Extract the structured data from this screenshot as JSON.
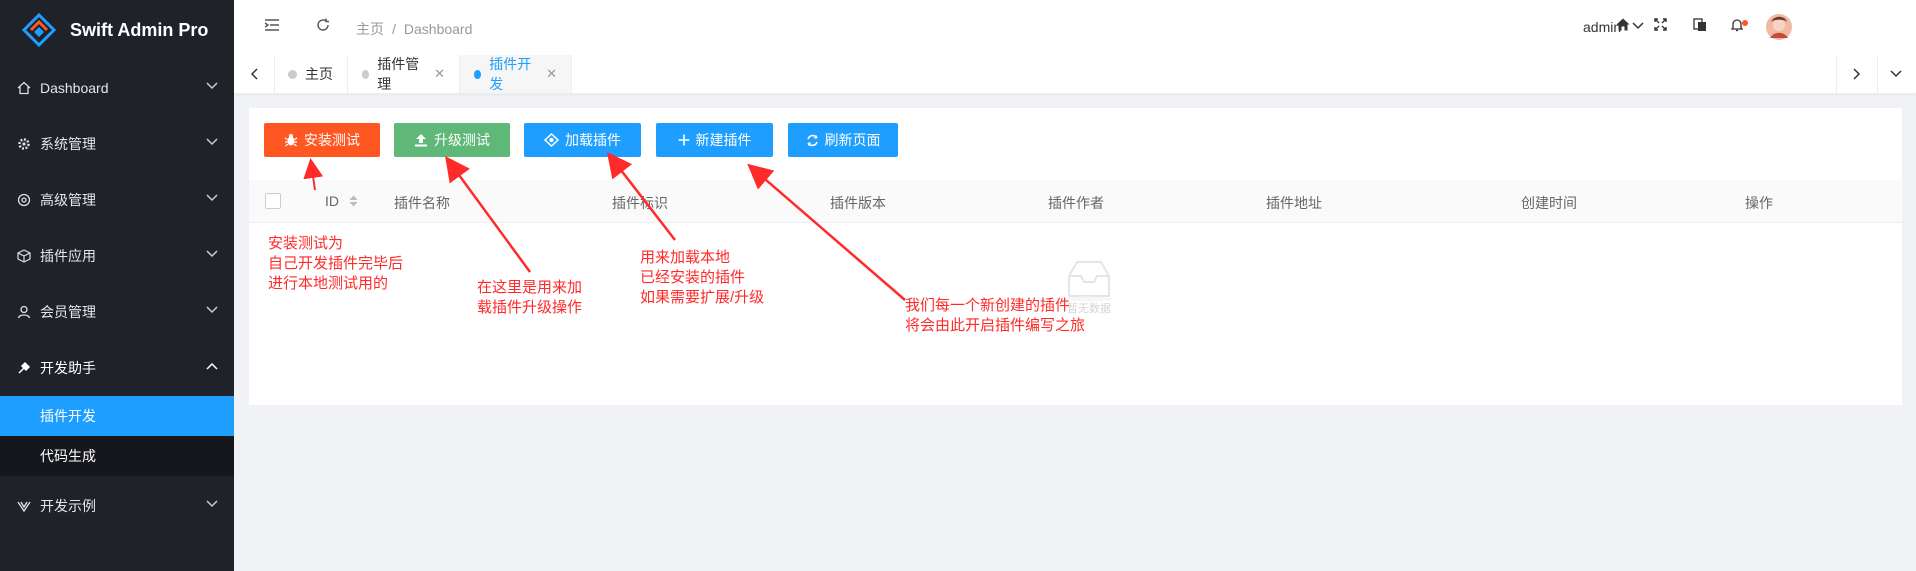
{
  "app": {
    "title": "Swift Admin Pro",
    "accent": "#1e9fff"
  },
  "sidebar": {
    "items": [
      {
        "label": "Dashboard",
        "icon": "home-icon"
      },
      {
        "label": "系统管理",
        "icon": "gear-icon"
      },
      {
        "label": "高级管理",
        "icon": "settings-icon"
      },
      {
        "label": "插件应用",
        "icon": "box-icon"
      },
      {
        "label": "会员管理",
        "icon": "user-icon"
      },
      {
        "label": "开发助手",
        "icon": "tool-icon",
        "expanded": true,
        "children": [
          {
            "label": "插件开发",
            "active": true
          },
          {
            "label": "代码生成"
          }
        ]
      },
      {
        "label": "开发示例",
        "icon": "lab-icon"
      }
    ]
  },
  "header": {
    "breadcrumb": [
      "主页",
      "Dashboard"
    ],
    "user": "admin"
  },
  "tabs": [
    {
      "label": "主页"
    },
    {
      "label": "插件管理"
    },
    {
      "label": "插件开发",
      "active": true
    }
  ],
  "toolbar": {
    "buttons": [
      {
        "label": "安装测试",
        "color": "#ff5722",
        "icon": "bug-icon"
      },
      {
        "label": "升级测试",
        "color": "#5fb878",
        "icon": "upload-icon"
      },
      {
        "label": "加载插件",
        "color": "#1e9fff",
        "icon": "load-icon"
      },
      {
        "label": "新建插件",
        "color": "#1e9fff",
        "icon": "plus-icon"
      },
      {
        "label": "刷新页面",
        "color": "#1e9fff",
        "icon": "refresh-icon"
      }
    ]
  },
  "table": {
    "columns": [
      "ID",
      "插件名称",
      "插件标识",
      "插件版本",
      "插件作者",
      "插件地址",
      "创建时间",
      "操作"
    ],
    "empty_text": "暂无数据"
  },
  "annotations": [
    {
      "lines": [
        "安装测试为",
        "自己开发插件完毕后",
        "进行本地测试用的"
      ]
    },
    {
      "lines": [
        "在这里是用来加",
        "载插件升级操作"
      ]
    },
    {
      "lines": [
        "用来加载本地",
        "已经安装的插件",
        "如果需要扩展/升级"
      ]
    },
    {
      "lines": [
        "我们每一个新创建的插件",
        "将会由此开启插件编写之旅"
      ]
    }
  ]
}
